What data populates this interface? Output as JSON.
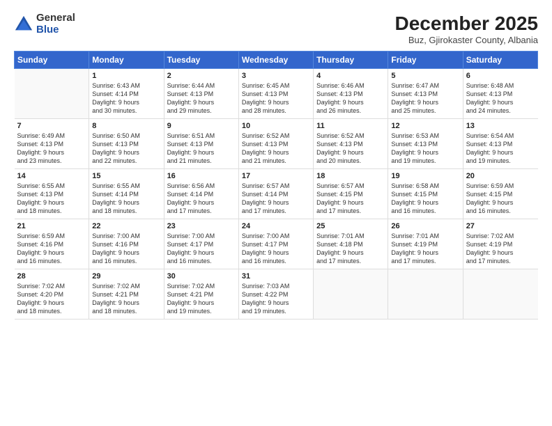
{
  "logo": {
    "general": "General",
    "blue": "Blue"
  },
  "header": {
    "title": "December 2025",
    "subtitle": "Buz, Gjirokaster County, Albania"
  },
  "days_of_week": [
    "Sunday",
    "Monday",
    "Tuesday",
    "Wednesday",
    "Thursday",
    "Friday",
    "Saturday"
  ],
  "weeks": [
    [
      {
        "day": "",
        "content": ""
      },
      {
        "day": "1",
        "content": "Sunrise: 6:43 AM\nSunset: 4:14 PM\nDaylight: 9 hours\nand 30 minutes."
      },
      {
        "day": "2",
        "content": "Sunrise: 6:44 AM\nSunset: 4:13 PM\nDaylight: 9 hours\nand 29 minutes."
      },
      {
        "day": "3",
        "content": "Sunrise: 6:45 AM\nSunset: 4:13 PM\nDaylight: 9 hours\nand 28 minutes."
      },
      {
        "day": "4",
        "content": "Sunrise: 6:46 AM\nSunset: 4:13 PM\nDaylight: 9 hours\nand 26 minutes."
      },
      {
        "day": "5",
        "content": "Sunrise: 6:47 AM\nSunset: 4:13 PM\nDaylight: 9 hours\nand 25 minutes."
      },
      {
        "day": "6",
        "content": "Sunrise: 6:48 AM\nSunset: 4:13 PM\nDaylight: 9 hours\nand 24 minutes."
      }
    ],
    [
      {
        "day": "7",
        "content": "Sunrise: 6:49 AM\nSunset: 4:13 PM\nDaylight: 9 hours\nand 23 minutes."
      },
      {
        "day": "8",
        "content": "Sunrise: 6:50 AM\nSunset: 4:13 PM\nDaylight: 9 hours\nand 22 minutes."
      },
      {
        "day": "9",
        "content": "Sunrise: 6:51 AM\nSunset: 4:13 PM\nDaylight: 9 hours\nand 21 minutes."
      },
      {
        "day": "10",
        "content": "Sunrise: 6:52 AM\nSunset: 4:13 PM\nDaylight: 9 hours\nand 21 minutes."
      },
      {
        "day": "11",
        "content": "Sunrise: 6:52 AM\nSunset: 4:13 PM\nDaylight: 9 hours\nand 20 minutes."
      },
      {
        "day": "12",
        "content": "Sunrise: 6:53 AM\nSunset: 4:13 PM\nDaylight: 9 hours\nand 19 minutes."
      },
      {
        "day": "13",
        "content": "Sunrise: 6:54 AM\nSunset: 4:13 PM\nDaylight: 9 hours\nand 19 minutes."
      }
    ],
    [
      {
        "day": "14",
        "content": "Sunrise: 6:55 AM\nSunset: 4:13 PM\nDaylight: 9 hours\nand 18 minutes."
      },
      {
        "day": "15",
        "content": "Sunrise: 6:55 AM\nSunset: 4:14 PM\nDaylight: 9 hours\nand 18 minutes."
      },
      {
        "day": "16",
        "content": "Sunrise: 6:56 AM\nSunset: 4:14 PM\nDaylight: 9 hours\nand 17 minutes."
      },
      {
        "day": "17",
        "content": "Sunrise: 6:57 AM\nSunset: 4:14 PM\nDaylight: 9 hours\nand 17 minutes."
      },
      {
        "day": "18",
        "content": "Sunrise: 6:57 AM\nSunset: 4:15 PM\nDaylight: 9 hours\nand 17 minutes."
      },
      {
        "day": "19",
        "content": "Sunrise: 6:58 AM\nSunset: 4:15 PM\nDaylight: 9 hours\nand 16 minutes."
      },
      {
        "day": "20",
        "content": "Sunrise: 6:59 AM\nSunset: 4:15 PM\nDaylight: 9 hours\nand 16 minutes."
      }
    ],
    [
      {
        "day": "21",
        "content": "Sunrise: 6:59 AM\nSunset: 4:16 PM\nDaylight: 9 hours\nand 16 minutes."
      },
      {
        "day": "22",
        "content": "Sunrise: 7:00 AM\nSunset: 4:16 PM\nDaylight: 9 hours\nand 16 minutes."
      },
      {
        "day": "23",
        "content": "Sunrise: 7:00 AM\nSunset: 4:17 PM\nDaylight: 9 hours\nand 16 minutes."
      },
      {
        "day": "24",
        "content": "Sunrise: 7:00 AM\nSunset: 4:17 PM\nDaylight: 9 hours\nand 16 minutes."
      },
      {
        "day": "25",
        "content": "Sunrise: 7:01 AM\nSunset: 4:18 PM\nDaylight: 9 hours\nand 17 minutes."
      },
      {
        "day": "26",
        "content": "Sunrise: 7:01 AM\nSunset: 4:19 PM\nDaylight: 9 hours\nand 17 minutes."
      },
      {
        "day": "27",
        "content": "Sunrise: 7:02 AM\nSunset: 4:19 PM\nDaylight: 9 hours\nand 17 minutes."
      }
    ],
    [
      {
        "day": "28",
        "content": "Sunrise: 7:02 AM\nSunset: 4:20 PM\nDaylight: 9 hours\nand 18 minutes."
      },
      {
        "day": "29",
        "content": "Sunrise: 7:02 AM\nSunset: 4:21 PM\nDaylight: 9 hours\nand 18 minutes."
      },
      {
        "day": "30",
        "content": "Sunrise: 7:02 AM\nSunset: 4:21 PM\nDaylight: 9 hours\nand 19 minutes."
      },
      {
        "day": "31",
        "content": "Sunrise: 7:03 AM\nSunset: 4:22 PM\nDaylight: 9 hours\nand 19 minutes."
      },
      {
        "day": "",
        "content": ""
      },
      {
        "day": "",
        "content": ""
      },
      {
        "day": "",
        "content": ""
      }
    ]
  ]
}
